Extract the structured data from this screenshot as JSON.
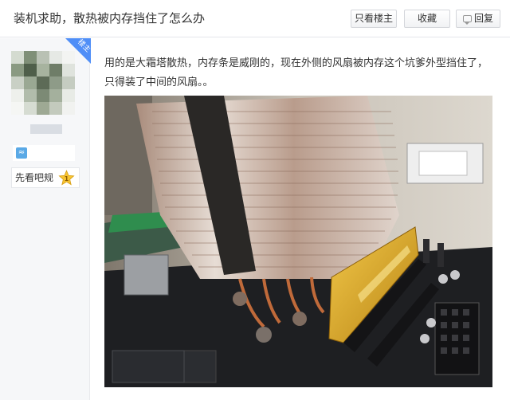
{
  "header": {
    "title": "装机求助，散热被内存挡住了怎么办",
    "buttons": {
      "only_op": "只看楼主",
      "collect": "收藏",
      "reply": "回复"
    }
  },
  "user": {
    "op_badge": "楼主",
    "medal_label": "先看吧规",
    "medal_value": "1"
  },
  "post": {
    "text": "用的是大霜塔散热，内存条是威刚的，现在外侧的风扇被内存这个坑爹外型挡住了，只得装了中间的风扇。。",
    "image_alt": "CPU tower cooler blocked by gold RAM stick"
  },
  "colors": {
    "accent": "#4f8ef7",
    "ram_gold": "#d9a520",
    "board": "#1e1f22"
  }
}
